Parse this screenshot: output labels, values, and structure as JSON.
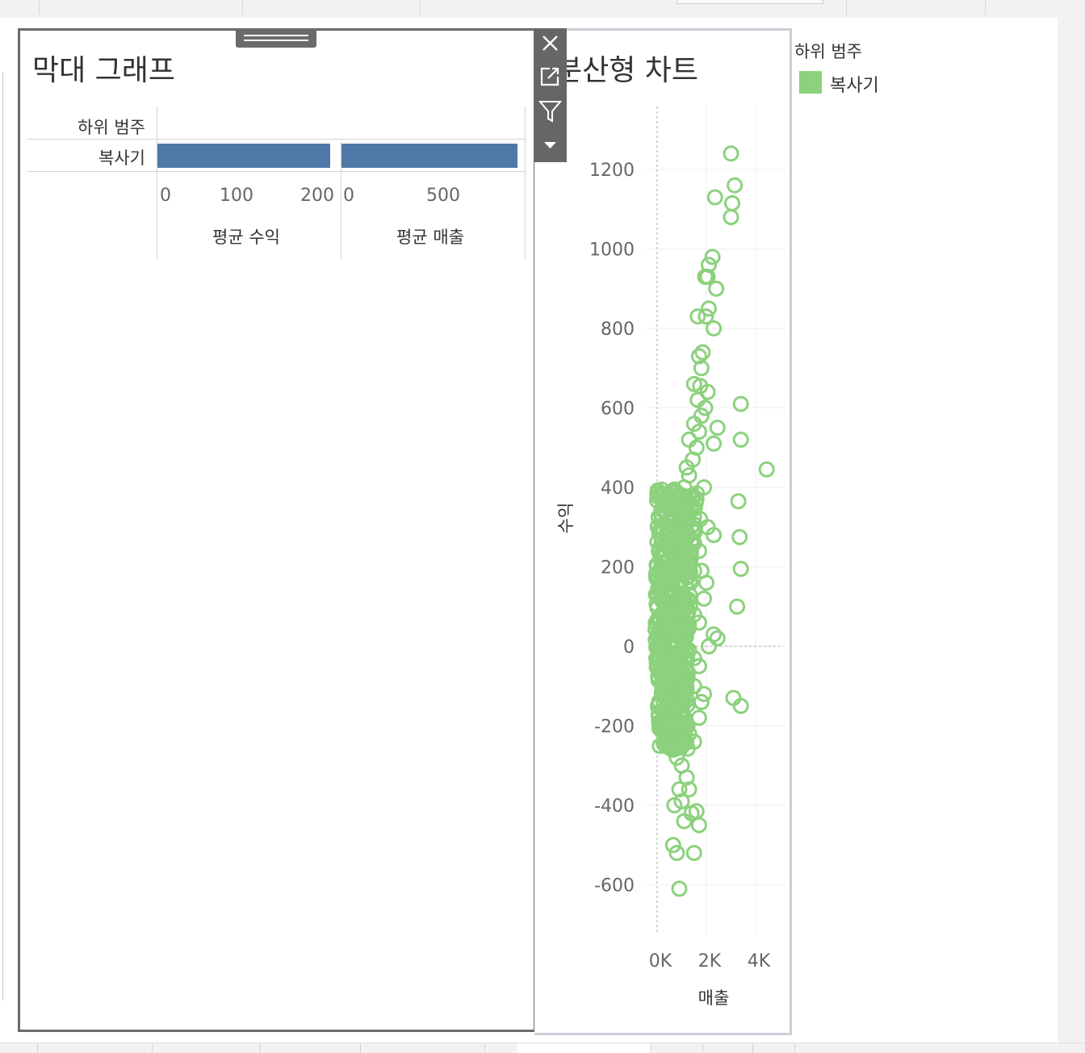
{
  "bar_chart": {
    "title": "막대 그래프",
    "row_header": "하위 범주",
    "row_label": "복사기",
    "panes": [
      {
        "axis_title": "평균 수익",
        "ticks": [
          "0",
          "100",
          "200"
        ],
        "value": 217,
        "max": 230
      },
      {
        "axis_title": "평균 매출",
        "ticks": [
          "0",
          "500"
        ],
        "value": 960,
        "max": 1000
      }
    ]
  },
  "scatter_chart": {
    "title_visible": "분산형 차트",
    "y_label": "수익",
    "x_label": "매출",
    "y_ticks": [
      "1200",
      "1000",
      "800",
      "600",
      "400",
      "200",
      "0",
      "-200",
      "-400",
      "-600"
    ],
    "x_ticks": [
      "0K",
      "2K",
      "4K"
    ]
  },
  "legend": {
    "title": "하위 범주",
    "items": [
      {
        "label": "복사기",
        "color": "#8cd17d"
      }
    ]
  },
  "colors": {
    "bar": "#4e79a7",
    "point": "#8cd17d",
    "frame": "#6b6b6b",
    "toolbar": "#666666"
  },
  "toolbar": {
    "icons": [
      "close-icon",
      "external-link-icon",
      "filter-icon",
      "dropdown-arrow-icon"
    ]
  },
  "chart_data": [
    {
      "type": "bar",
      "categories": [
        "복사기"
      ],
      "series": [
        {
          "name": "평균 수익",
          "values": [
            217
          ]
        },
        {
          "name": "평균 매출",
          "values": [
            960
          ]
        }
      ],
      "title": "막대 그래프",
      "ylabel": "하위 범주",
      "xlim_by_series": [
        [
          0,
          230
        ],
        [
          0,
          1000
        ]
      ]
    },
    {
      "type": "scatter",
      "title": "분산형 차트",
      "xlabel": "매출",
      "ylabel": "수익",
      "xlim": [
        0,
        5000
      ],
      "ylim": [
        -700,
        1350
      ],
      "grid": true,
      "series": [
        {
          "name": "복사기",
          "points": [
            [
              3000,
              1240
            ],
            [
              3150,
              1160
            ],
            [
              3050,
              1115
            ],
            [
              2350,
              1130
            ],
            [
              3000,
              1080
            ],
            [
              2250,
              980
            ],
            [
              2100,
              960
            ],
            [
              2400,
              900
            ],
            [
              2050,
              930
            ],
            [
              1950,
              930
            ],
            [
              2100,
              850
            ],
            [
              1980,
              830
            ],
            [
              1650,
              830
            ],
            [
              2300,
              800
            ],
            [
              1700,
              730
            ],
            [
              1850,
              740
            ],
            [
              1800,
              700
            ],
            [
              1500,
              660
            ],
            [
              1750,
              655
            ],
            [
              2050,
              640
            ],
            [
              1650,
              620
            ],
            [
              1950,
              600
            ],
            [
              1800,
              580
            ],
            [
              1500,
              560
            ],
            [
              1700,
              540
            ],
            [
              3400,
              610
            ],
            [
              1300,
              520
            ],
            [
              1600,
              500
            ],
            [
              1450,
              470
            ],
            [
              1200,
              450
            ],
            [
              1300,
              430
            ],
            [
              2450,
              550
            ],
            [
              2300,
              510
            ],
            [
              3400,
              520
            ],
            [
              4450,
              445
            ],
            [
              3300,
              365
            ],
            [
              3350,
              275
            ],
            [
              3400,
              195
            ],
            [
              3250,
              100
            ],
            [
              1100,
              400
            ],
            [
              1000,
              380
            ],
            [
              1200,
              350
            ],
            [
              1600,
              370
            ],
            [
              1900,
              400
            ],
            [
              1750,
              320
            ],
            [
              1000,
              300
            ],
            [
              1300,
              280
            ],
            [
              1500,
              260
            ],
            [
              1700,
              240
            ],
            [
              2050,
              300
            ],
            [
              2300,
              280
            ],
            [
              900,
              220
            ],
            [
              1100,
              200
            ],
            [
              1500,
              190
            ],
            [
              1800,
              190
            ],
            [
              2000,
              160
            ],
            [
              1900,
              120
            ],
            [
              800,
              150
            ],
            [
              1000,
              120
            ],
            [
              1200,
              100
            ],
            [
              1500,
              80
            ],
            [
              1700,
              60
            ],
            [
              2300,
              30
            ],
            [
              2450,
              20
            ],
            [
              2100,
              0
            ],
            [
              700,
              60
            ],
            [
              900,
              30
            ],
            [
              1100,
              10
            ],
            [
              1300,
              -10
            ],
            [
              1500,
              -30
            ],
            [
              1700,
              -50
            ],
            [
              600,
              -20
            ],
            [
              800,
              -60
            ],
            [
              1000,
              -90
            ],
            [
              1200,
              -110
            ],
            [
              1500,
              -100
            ],
            [
              1800,
              -140
            ],
            [
              1900,
              -120
            ],
            [
              700,
              -130
            ],
            [
              900,
              -170
            ],
            [
              1100,
              -200
            ],
            [
              1300,
              -220
            ],
            [
              1500,
              -240
            ],
            [
              1700,
              -180
            ],
            [
              3100,
              -130
            ],
            [
              3400,
              -150
            ],
            [
              600,
              -250
            ],
            [
              800,
              -280
            ],
            [
              1000,
              -300
            ],
            [
              1200,
              -330
            ],
            [
              900,
              -360
            ],
            [
              1000,
              -390
            ],
            [
              700,
              -400
            ],
            [
              1300,
              -360
            ],
            [
              1400,
              -420
            ],
            [
              1100,
              -440
            ],
            [
              1700,
              -450
            ],
            [
              1600,
              -415
            ],
            [
              650,
              -500
            ],
            [
              800,
              -520
            ],
            [
              1500,
              -520
            ],
            [
              900,
              -610
            ]
          ]
        }
      ]
    }
  ]
}
